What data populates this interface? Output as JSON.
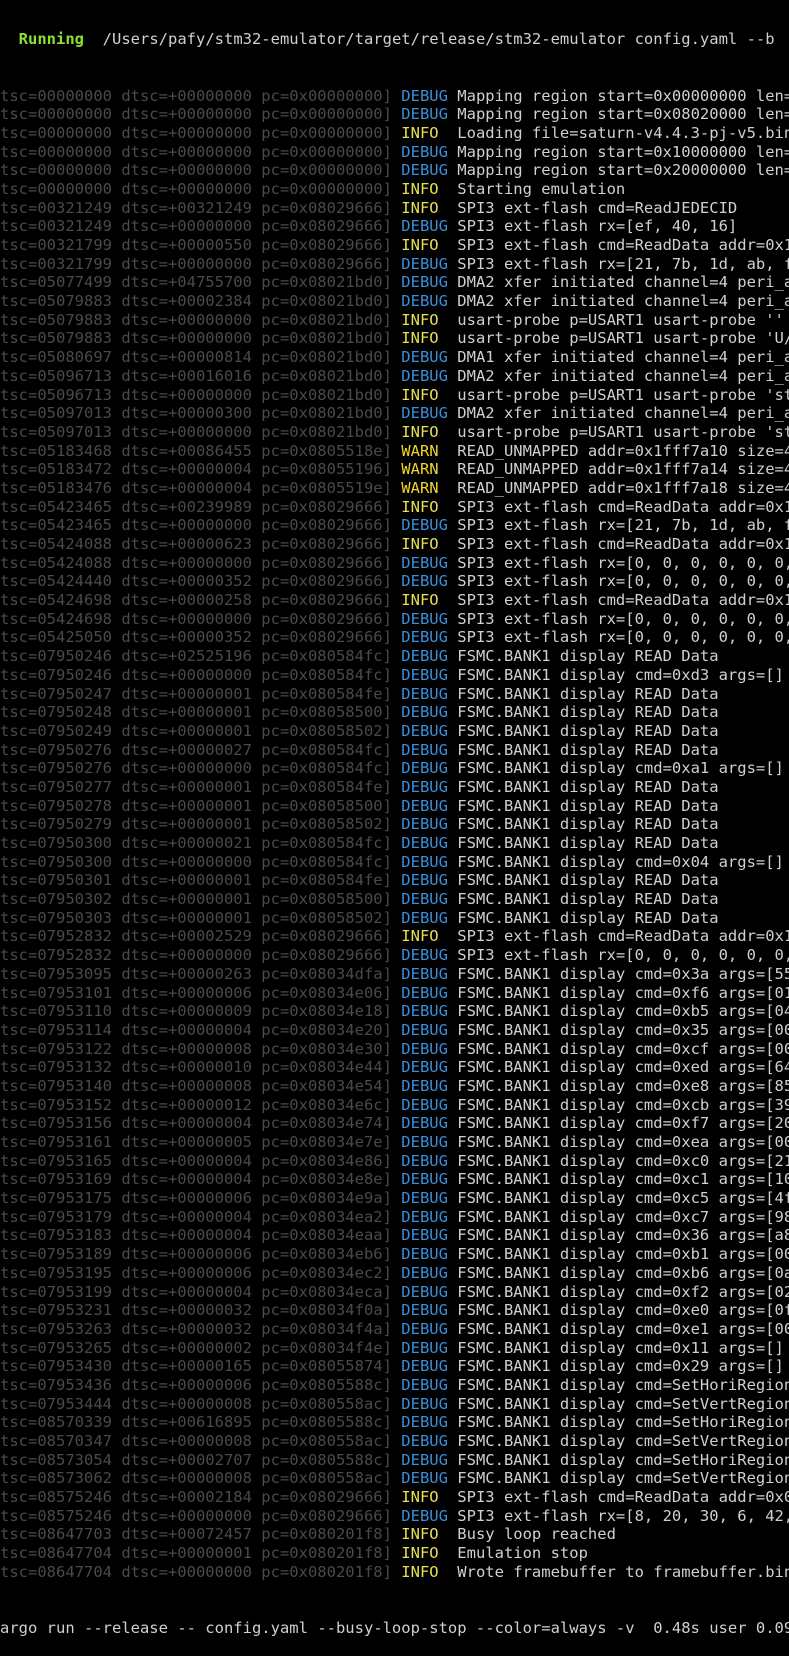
{
  "header": {
    "status": "Running",
    "command": "/Users/pafy/stm32-emulator/target/release/stm32-emulator config.yaml --b"
  },
  "colors": {
    "background": "#000000",
    "prefix": "#4a4a4a",
    "debug": "#3a8fd8",
    "info": "#e5e052",
    "warn": "#f0d42a",
    "running": "#8ae234",
    "text": "#d0d0d0"
  },
  "lines": [
    {
      "prefix": "tsc=00000000 dtsc=+00000000 pc=0x00000000]",
      "level": "DEBUG",
      "msg": "Mapping region start=0x00000000 len="
    },
    {
      "prefix": "tsc=00000000 dtsc=+00000000 pc=0x00000000]",
      "level": "DEBUG",
      "msg": "Mapping region start=0x08020000 len="
    },
    {
      "prefix": "tsc=00000000 dtsc=+00000000 pc=0x00000000]",
      "level": "INFO",
      "msg": "Loading file=saturn-v4.4.3-pj-v5.bin"
    },
    {
      "prefix": "tsc=00000000 dtsc=+00000000 pc=0x00000000]",
      "level": "DEBUG",
      "msg": "Mapping region start=0x10000000 len="
    },
    {
      "prefix": "tsc=00000000 dtsc=+00000000 pc=0x00000000]",
      "level": "DEBUG",
      "msg": "Mapping region start=0x20000000 len="
    },
    {
      "prefix": "tsc=00000000 dtsc=+00000000 pc=0x00000000]",
      "level": "INFO",
      "msg": "Starting emulation"
    },
    {
      "prefix": "tsc=00321249 dtsc=+00321249 pc=0x08029666]",
      "level": "INFO",
      "msg": "SPI3 ext-flash cmd=ReadJEDECID"
    },
    {
      "prefix": "tsc=00321249 dtsc=+00000000 pc=0x08029666]",
      "level": "DEBUG",
      "msg": "SPI3 ext-flash rx=[ef, 40, 16]"
    },
    {
      "prefix": "tsc=00321799 dtsc=+00000550 pc=0x08029666]",
      "level": "INFO",
      "msg": "SPI3 ext-flash cmd=ReadData addr=0x1"
    },
    {
      "prefix": "tsc=00321799 dtsc=+00000000 pc=0x08029666]",
      "level": "DEBUG",
      "msg": "SPI3 ext-flash rx=[21, 7b, 1d, ab, f"
    },
    {
      "prefix": "tsc=05077499 dtsc=+04755700 pc=0x08021bd0]",
      "level": "DEBUG",
      "msg": "DMA2 xfer initiated channel=4 peri_a"
    },
    {
      "prefix": "tsc=05079883 dtsc=+00002384 pc=0x08021bd0]",
      "level": "DEBUG",
      "msg": "DMA2 xfer initiated channel=4 peri_a"
    },
    {
      "prefix": "tsc=05079883 dtsc=+00000000 pc=0x08021bd0]",
      "level": "INFO",
      "msg": "usart-probe p=USART1 usart-probe ''"
    },
    {
      "prefix": "tsc=05079883 dtsc=+00000000 pc=0x08021bd0]",
      "level": "INFO",
      "msg": "usart-probe p=USART1 usart-probe 'U/"
    },
    {
      "prefix": "tsc=05080697 dtsc=+00000814 pc=0x08021bd0]",
      "level": "DEBUG",
      "msg": "DMA1 xfer initiated channel=4 peri_a"
    },
    {
      "prefix": "tsc=05096713 dtsc=+00016016 pc=0x08021bd0]",
      "level": "DEBUG",
      "msg": "DMA2 xfer initiated channel=4 peri_a"
    },
    {
      "prefix": "tsc=05096713 dtsc=+00000000 pc=0x08021bd0]",
      "level": "INFO",
      "msg": "usart-probe p=USART1 usart-probe 'st"
    },
    {
      "prefix": "tsc=05097013 dtsc=+00000300 pc=0x08021bd0]",
      "level": "DEBUG",
      "msg": "DMA2 xfer initiated channel=4 peri_a"
    },
    {
      "prefix": "tsc=05097013 dtsc=+00000000 pc=0x08021bd0]",
      "level": "INFO",
      "msg": "usart-probe p=USART1 usart-probe 'st"
    },
    {
      "prefix": "tsc=05183468 dtsc=+00086455 pc=0x0805518e]",
      "level": "WARN",
      "msg": "READ_UNMAPPED addr=0x1fff7a10 size=4"
    },
    {
      "prefix": "tsc=05183472 dtsc=+00000004 pc=0x08055196]",
      "level": "WARN",
      "msg": "READ_UNMAPPED addr=0x1fff7a14 size=4"
    },
    {
      "prefix": "tsc=05183476 dtsc=+00000004 pc=0x0805519e]",
      "level": "WARN",
      "msg": "READ_UNMAPPED addr=0x1fff7a18 size=4"
    },
    {
      "prefix": "tsc=05423465 dtsc=+00239989 pc=0x08029666]",
      "level": "INFO",
      "msg": "SPI3 ext-flash cmd=ReadData addr=0x1"
    },
    {
      "prefix": "tsc=05423465 dtsc=+00000000 pc=0x08029666]",
      "level": "DEBUG",
      "msg": "SPI3 ext-flash rx=[21, 7b, 1d, ab, f"
    },
    {
      "prefix": "tsc=05424088 dtsc=+00000623 pc=0x08029666]",
      "level": "INFO",
      "msg": "SPI3 ext-flash cmd=ReadData addr=0x1"
    },
    {
      "prefix": "tsc=05424088 dtsc=+00000000 pc=0x08029666]",
      "level": "DEBUG",
      "msg": "SPI3 ext-flash rx=[0, 0, 0, 0, 0, 0,"
    },
    {
      "prefix": "tsc=05424440 dtsc=+00000352 pc=0x08029666]",
      "level": "DEBUG",
      "msg": "SPI3 ext-flash rx=[0, 0, 0, 0, 0, 0,"
    },
    {
      "prefix": "tsc=05424698 dtsc=+00000258 pc=0x08029666]",
      "level": "INFO",
      "msg": "SPI3 ext-flash cmd=ReadData addr=0x1"
    },
    {
      "prefix": "tsc=05424698 dtsc=+00000000 pc=0x08029666]",
      "level": "DEBUG",
      "msg": "SPI3 ext-flash rx=[0, 0, 0, 0, 0, 0,"
    },
    {
      "prefix": "tsc=05425050 dtsc=+00000352 pc=0x08029666]",
      "level": "DEBUG",
      "msg": "SPI3 ext-flash rx=[0, 0, 0, 0, 0, 0,"
    },
    {
      "prefix": "tsc=07950246 dtsc=+02525196 pc=0x080584fc]",
      "level": "DEBUG",
      "msg": "FSMC.BANK1 display READ Data"
    },
    {
      "prefix": "tsc=07950246 dtsc=+00000000 pc=0x080584fc]",
      "level": "DEBUG",
      "msg": "FSMC.BANK1 display cmd=0xd3 args=[]"
    },
    {
      "prefix": "tsc=07950247 dtsc=+00000001 pc=0x080584fe]",
      "level": "DEBUG",
      "msg": "FSMC.BANK1 display READ Data"
    },
    {
      "prefix": "tsc=07950248 dtsc=+00000001 pc=0x08058500]",
      "level": "DEBUG",
      "msg": "FSMC.BANK1 display READ Data"
    },
    {
      "prefix": "tsc=07950249 dtsc=+00000001 pc=0x08058502]",
      "level": "DEBUG",
      "msg": "FSMC.BANK1 display READ Data"
    },
    {
      "prefix": "tsc=07950276 dtsc=+00000027 pc=0x080584fc]",
      "level": "DEBUG",
      "msg": "FSMC.BANK1 display READ Data"
    },
    {
      "prefix": "tsc=07950276 dtsc=+00000000 pc=0x080584fc]",
      "level": "DEBUG",
      "msg": "FSMC.BANK1 display cmd=0xa1 args=[]"
    },
    {
      "prefix": "tsc=07950277 dtsc=+00000001 pc=0x080584fe]",
      "level": "DEBUG",
      "msg": "FSMC.BANK1 display READ Data"
    },
    {
      "prefix": "tsc=07950278 dtsc=+00000001 pc=0x08058500]",
      "level": "DEBUG",
      "msg": "FSMC.BANK1 display READ Data"
    },
    {
      "prefix": "tsc=07950279 dtsc=+00000001 pc=0x08058502]",
      "level": "DEBUG",
      "msg": "FSMC.BANK1 display READ Data"
    },
    {
      "prefix": "tsc=07950300 dtsc=+00000021 pc=0x080584fc]",
      "level": "DEBUG",
      "msg": "FSMC.BANK1 display READ Data"
    },
    {
      "prefix": "tsc=07950300 dtsc=+00000000 pc=0x080584fc]",
      "level": "DEBUG",
      "msg": "FSMC.BANK1 display cmd=0x04 args=[]"
    },
    {
      "prefix": "tsc=07950301 dtsc=+00000001 pc=0x080584fe]",
      "level": "DEBUG",
      "msg": "FSMC.BANK1 display READ Data"
    },
    {
      "prefix": "tsc=07950302 dtsc=+00000001 pc=0x08058500]",
      "level": "DEBUG",
      "msg": "FSMC.BANK1 display READ Data"
    },
    {
      "prefix": "tsc=07950303 dtsc=+00000001 pc=0x08058502]",
      "level": "DEBUG",
      "msg": "FSMC.BANK1 display READ Data"
    },
    {
      "prefix": "tsc=07952832 dtsc=+00002529 pc=0x08029666]",
      "level": "INFO",
      "msg": "SPI3 ext-flash cmd=ReadData addr=0x1"
    },
    {
      "prefix": "tsc=07952832 dtsc=+00000000 pc=0x08029666]",
      "level": "DEBUG",
      "msg": "SPI3 ext-flash rx=[0, 0, 0, 0, 0, 0,"
    },
    {
      "prefix": "tsc=07953095 dtsc=+00000263 pc=0x08034dfa]",
      "level": "DEBUG",
      "msg": "FSMC.BANK1 display cmd=0x3a args=[55"
    },
    {
      "prefix": "tsc=07953101 dtsc=+00000006 pc=0x08034e06]",
      "level": "DEBUG",
      "msg": "FSMC.BANK1 display cmd=0xf6 args=[01"
    },
    {
      "prefix": "tsc=07953110 dtsc=+00000009 pc=0x08034e18]",
      "level": "DEBUG",
      "msg": "FSMC.BANK1 display cmd=0xb5 args=[04"
    },
    {
      "prefix": "tsc=07953114 dtsc=+00000004 pc=0x08034e20]",
      "level": "DEBUG",
      "msg": "FSMC.BANK1 display cmd=0x35 args=[00"
    },
    {
      "prefix": "tsc=07953122 dtsc=+00000008 pc=0x08034e30]",
      "level": "DEBUG",
      "msg": "FSMC.BANK1 display cmd=0xcf args=[00"
    },
    {
      "prefix": "tsc=07953132 dtsc=+00000010 pc=0x08034e44]",
      "level": "DEBUG",
      "msg": "FSMC.BANK1 display cmd=0xed args=[64"
    },
    {
      "prefix": "tsc=07953140 dtsc=+00000008 pc=0x08034e54]",
      "level": "DEBUG",
      "msg": "FSMC.BANK1 display cmd=0xe8 args=[85"
    },
    {
      "prefix": "tsc=07953152 dtsc=+00000012 pc=0x08034e6c]",
      "level": "DEBUG",
      "msg": "FSMC.BANK1 display cmd=0xcb args=[39"
    },
    {
      "prefix": "tsc=07953156 dtsc=+00000004 pc=0x08034e74]",
      "level": "DEBUG",
      "msg": "FSMC.BANK1 display cmd=0xf7 args=[20"
    },
    {
      "prefix": "tsc=07953161 dtsc=+00000005 pc=0x08034e7e]",
      "level": "DEBUG",
      "msg": "FSMC.BANK1 display cmd=0xea args=[00"
    },
    {
      "prefix": "tsc=07953165 dtsc=+00000004 pc=0x08034e86]",
      "level": "DEBUG",
      "msg": "FSMC.BANK1 display cmd=0xc0 args=[21"
    },
    {
      "prefix": "tsc=07953169 dtsc=+00000004 pc=0x08034e8e]",
      "level": "DEBUG",
      "msg": "FSMC.BANK1 display cmd=0xc1 args=[10"
    },
    {
      "prefix": "tsc=07953175 dtsc=+00000006 pc=0x08034e9a]",
      "level": "DEBUG",
      "msg": "FSMC.BANK1 display cmd=0xc5 args=[4f"
    },
    {
      "prefix": "tsc=07953179 dtsc=+00000004 pc=0x08034ea2]",
      "level": "DEBUG",
      "msg": "FSMC.BANK1 display cmd=0xc7 args=[98"
    },
    {
      "prefix": "tsc=07953183 dtsc=+00000004 pc=0x08034eaa]",
      "level": "DEBUG",
      "msg": "FSMC.BANK1 display cmd=0x36 args=[a8"
    },
    {
      "prefix": "tsc=07953189 dtsc=+00000006 pc=0x08034eb6]",
      "level": "DEBUG",
      "msg": "FSMC.BANK1 display cmd=0xb1 args=[00"
    },
    {
      "prefix": "tsc=07953195 dtsc=+00000006 pc=0x08034ec2]",
      "level": "DEBUG",
      "msg": "FSMC.BANK1 display cmd=0xb6 args=[0a"
    },
    {
      "prefix": "tsc=07953199 dtsc=+00000004 pc=0x08034eca]",
      "level": "DEBUG",
      "msg": "FSMC.BANK1 display cmd=0xf2 args=[02"
    },
    {
      "prefix": "tsc=07953231 dtsc=+00000032 pc=0x08034f0a]",
      "level": "DEBUG",
      "msg": "FSMC.BANK1 display cmd=0xe0 args=[0f"
    },
    {
      "prefix": "tsc=07953263 dtsc=+00000032 pc=0x08034f4a]",
      "level": "DEBUG",
      "msg": "FSMC.BANK1 display cmd=0xe1 args=[00"
    },
    {
      "prefix": "tsc=07953265 dtsc=+00000002 pc=0x08034f4e]",
      "level": "DEBUG",
      "msg": "FSMC.BANK1 display cmd=0x11 args=[]"
    },
    {
      "prefix": "tsc=07953430 dtsc=+00000165 pc=0x08055874]",
      "level": "DEBUG",
      "msg": "FSMC.BANK1 display cmd=0x29 args=[]"
    },
    {
      "prefix": "tsc=07953436 dtsc=+00000006 pc=0x0805588c]",
      "level": "DEBUG",
      "msg": "FSMC.BANK1 display cmd=SetHoriRegion"
    },
    {
      "prefix": "tsc=07953444 dtsc=+00000008 pc=0x080558ac]",
      "level": "DEBUG",
      "msg": "FSMC.BANK1 display cmd=SetVertRegion"
    },
    {
      "prefix": "tsc=08570339 dtsc=+00616895 pc=0x0805588c]",
      "level": "DEBUG",
      "msg": "FSMC.BANK1 display cmd=SetHoriRegion"
    },
    {
      "prefix": "tsc=08570347 dtsc=+00000008 pc=0x080558ac]",
      "level": "DEBUG",
      "msg": "FSMC.BANK1 display cmd=SetVertRegion"
    },
    {
      "prefix": "tsc=08573054 dtsc=+00002707 pc=0x0805588c]",
      "level": "DEBUG",
      "msg": "FSMC.BANK1 display cmd=SetHoriRegion"
    },
    {
      "prefix": "tsc=08573062 dtsc=+00000008 pc=0x080558ac]",
      "level": "DEBUG",
      "msg": "FSMC.BANK1 display cmd=SetVertRegion"
    },
    {
      "prefix": "tsc=08575246 dtsc=+00002184 pc=0x08029666]",
      "level": "INFO",
      "msg": "SPI3 ext-flash cmd=ReadData addr=0x0"
    },
    {
      "prefix": "tsc=08575246 dtsc=+00000000 pc=0x08029666]",
      "level": "DEBUG",
      "msg": "SPI3 ext-flash rx=[8, 20, 30, 6, 42,"
    },
    {
      "prefix": "tsc=08647703 dtsc=+00072457 pc=0x080201f8]",
      "level": "INFO",
      "msg": "Busy loop reached"
    },
    {
      "prefix": "tsc=08647704 dtsc=+00000001 pc=0x080201f8]",
      "level": "INFO",
      "msg": "Emulation stop"
    },
    {
      "prefix": "tsc=08647704 dtsc=+00000000 pc=0x080201f8]",
      "level": "INFO",
      "msg": "Wrote framebuffer to framebuffer.bin"
    }
  ],
  "footer": {
    "text": "argo run --release -- config.yaml --busy-loop-stop --color=always -v  0.48s user 0.09"
  }
}
